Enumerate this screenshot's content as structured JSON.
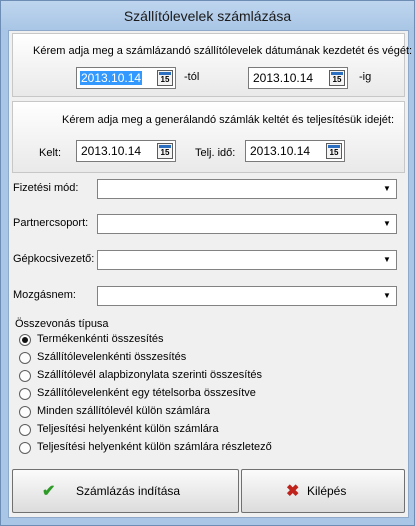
{
  "window": {
    "title": "Szállítólevelek számlázása"
  },
  "delivery_range": {
    "prompt": "Kérem adja meg a számlázandó szállítólevelek dátumának kezdetét és végét:",
    "from_value": "2013.10.14",
    "from_suffix": "-tól",
    "to_value": "2013.10.14",
    "to_suffix": "-ig"
  },
  "invoice_dates": {
    "prompt": "Kérem adja meg a generálandó számlák keltét és teljesítésük idejét:",
    "issue_label": "Kelt:",
    "issue_value": "2013.10.14",
    "fulfil_label": "Telj. idő:",
    "fulfil_value": "2013.10.14"
  },
  "calendar_button_glyph": "15",
  "filters": [
    {
      "label": "Fizetési mód:",
      "value": ""
    },
    {
      "label": "Partnercsoport:",
      "value": ""
    },
    {
      "label": "Gépkocsivezető:",
      "value": ""
    },
    {
      "label": "Mozgásnem:",
      "value": ""
    }
  ],
  "dropdown_arrow": "▼",
  "grouping": {
    "title": "Összevonás típusa",
    "selected_index": 0,
    "options": [
      "Termékenkénti összesítés",
      "Szállítólevelenkénti összesítés",
      "Szállítólevél alapbizonylata szerinti összesítés",
      "Szállítólevelenként egy tételsorba összesítve",
      "Minden szállítólevél külön számlára",
      "Teljesítési helyenként külön számlára",
      "Teljesítési helyenként külön számlára részletező"
    ]
  },
  "buttons": {
    "start_label": "Számlázás indítása",
    "start_icon": "✔",
    "exit_label": "Kilépés",
    "exit_icon": "✖"
  },
  "colors": {
    "selection": "#3399ff",
    "title_bar": "#a9c6e6",
    "ok_icon": "#2e9b28",
    "exit_icon": "#c0221c"
  }
}
